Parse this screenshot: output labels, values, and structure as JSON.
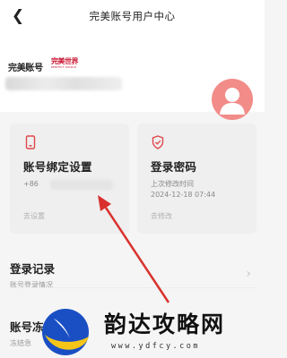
{
  "header": {
    "title": "完美账号用户中心",
    "back_icon": "chevron-left-icon"
  },
  "profile": {
    "brand_logo_text": "完美账号",
    "partner_logo_text": "完美世界",
    "partner_logo_en": "PERFECT WORLD",
    "avatar_color": "#f28c88"
  },
  "cards": {
    "binding": {
      "icon": "phone-icon",
      "title": "账号绑定设置",
      "phone_prefix": "+86",
      "link": "去设置"
    },
    "password": {
      "icon": "shield-icon",
      "title": "登录密码",
      "last_modified_label": "上次修改时间",
      "last_modified_value": "2024-12-18 07:44",
      "link": "去修改"
    }
  },
  "rows": {
    "login_record": {
      "title": "登录记录",
      "subtitle": "账号登录情况"
    },
    "account_freeze": {
      "title": "账号冻",
      "subtitle": "冻结急"
    }
  },
  "watermark": {
    "text": "韵达攻略网",
    "url": "www.ydfcy.com"
  },
  "colors": {
    "accent_red": "#e0474c",
    "arrow_red": "#d9322e",
    "card_bg": "#efefef"
  }
}
